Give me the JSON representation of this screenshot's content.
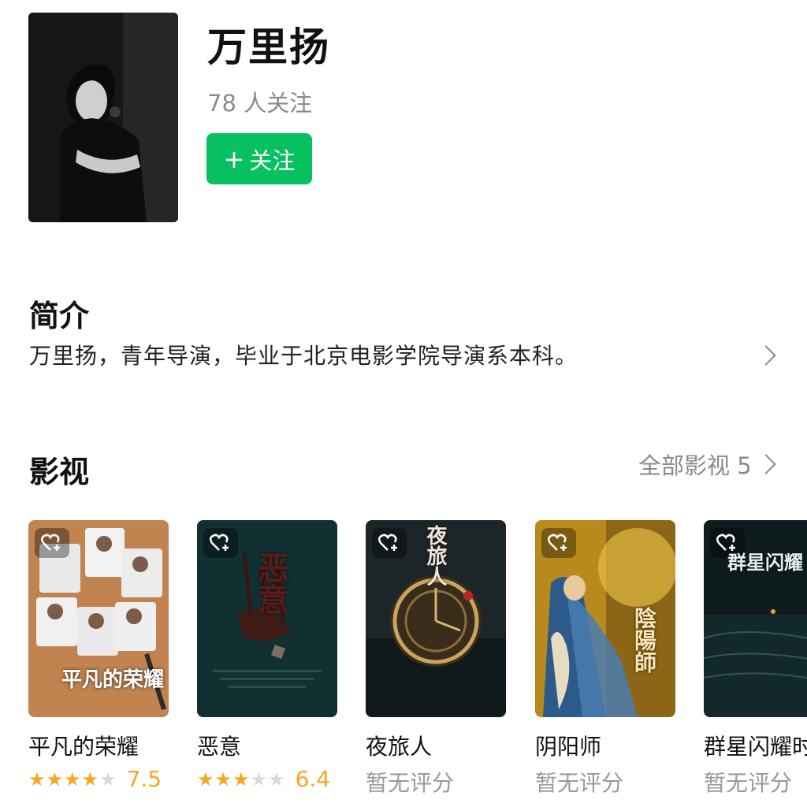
{
  "profile": {
    "name": "万里扬",
    "followers": "78 人关注",
    "follow_button": "关注",
    "follow_plus": "+"
  },
  "intro": {
    "title": "简介",
    "text": "万里扬，青年导演，毕业于北京电影学院导演系本科。"
  },
  "works": {
    "title": "影视",
    "all_label": "全部影视 5",
    "items": [
      {
        "title": "平凡的荣耀",
        "poster_text": "平凡的荣耀",
        "stars": 4,
        "score": "7.5",
        "no_score": ""
      },
      {
        "title": "恶意",
        "poster_text": "恶意",
        "stars": 3,
        "score": "6.4",
        "no_score": ""
      },
      {
        "title": "夜旅人",
        "poster_text": "夜旅人",
        "stars": 0,
        "score": "",
        "no_score": "暂无评分"
      },
      {
        "title": "阴阳师",
        "poster_text": "陰陽師",
        "stars": 0,
        "score": "",
        "no_score": "暂无评分"
      },
      {
        "title": "群星闪耀时",
        "poster_text": "群星闪耀",
        "stars": 0,
        "score": "",
        "no_score": "暂无评分"
      }
    ]
  },
  "colors": {
    "accent_green": "#07c160",
    "star": "#f5a623",
    "muted": "#8a8a8a"
  }
}
